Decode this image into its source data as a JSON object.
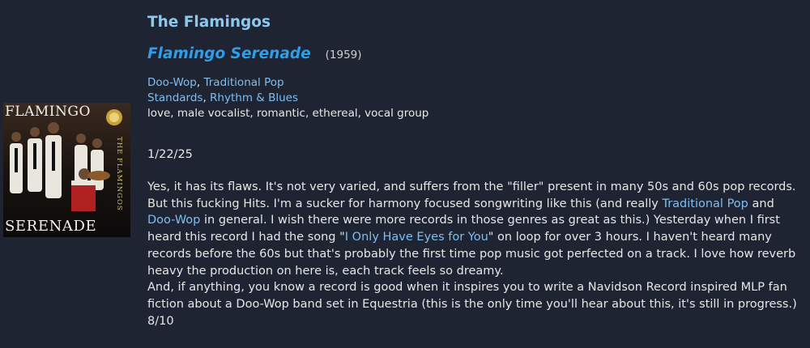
{
  "artist": "The Flamingos",
  "album": {
    "title": "Flamingo Serenade",
    "year": "(1959)",
    "cover_text_top": "FLAMINGO",
    "cover_text_bottom": "SERENADE",
    "cover_text_side": "THE FLAMINGOS"
  },
  "genres": {
    "primary": [
      "Doo-Wop",
      "Traditional Pop"
    ],
    "secondary": [
      "Standards",
      "Rhythm & Blues"
    ],
    "separator": ", "
  },
  "descriptors": "love, male vocalist, romantic, ethereal, vocal group",
  "review": {
    "date": "1/22/25",
    "p1_a": "Yes, it has its flaws. It's not very varied, and suffers from the \"filler\" present in many 50s and 60s pop records. But this fucking Hits. I'm a sucker for harmony focused songwriting like this (and really ",
    "p1_link1": "Traditional Pop",
    "p1_b": " and ",
    "p1_link2": "Doo-Wop",
    "p1_c": " in general. I wish there were more records in those genres as great as this.) Yesterday when I first heard this record I had the song \"",
    "p1_link3": "I Only Have Eyes for You",
    "p1_d": "\" on loop for over 3 hours. I haven't heard many records before the 60s but that's probably the first time pop music got perfected on a track. I love how reverb heavy the production on here is, each track feels so dreamy.",
    "p2": "And, if anything, you know a record is good when it inspires you to write a Navidson Record inspired MLP fan fiction about a Doo-Wop band set in Equestria (this is the only time you'll hear about this, it's still in progress.)",
    "rating": "8/10"
  },
  "colors": {
    "background": "#1f2432",
    "artist": "#8cc8f0",
    "album_title": "#2e9ee8",
    "link": "#7fbef0",
    "text": "#e8e8e8"
  }
}
